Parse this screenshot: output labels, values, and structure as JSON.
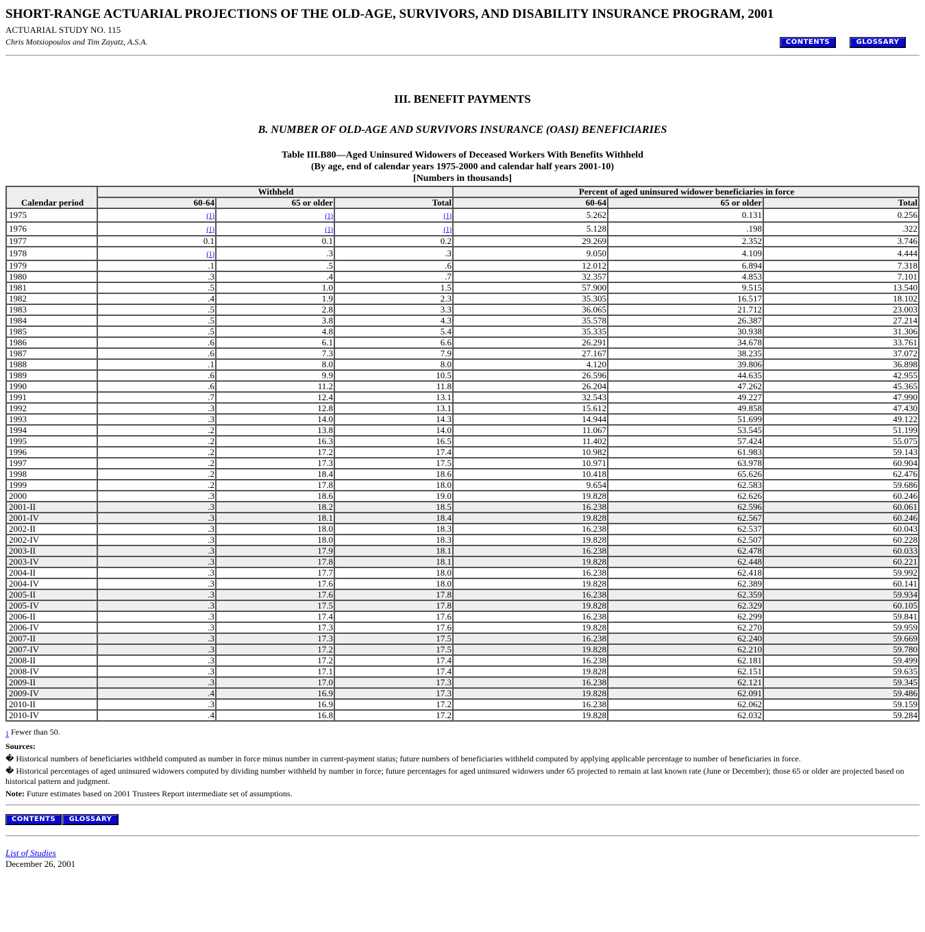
{
  "header": {
    "title": "SHORT-RANGE ACTUARIAL PROJECTIONS OF THE OLD-AGE, SURVIVORS, AND DISABILITY INSURANCE PROGRAM, 2001",
    "study_no": "ACTUARIAL STUDY NO. 115",
    "authors": "Chris Motsiopoulos and Tim Zayatz, A.S.A.",
    "contents_label": "CONTENTS",
    "glossary_label": "GLOSSARY"
  },
  "section_title": "III. BENEFIT PAYMENTS",
  "subsection_title": "B. NUMBER OF OLD-AGE AND SURVIVORS INSURANCE (OASI) BENEFICIARIES",
  "table": {
    "caption_line1": "Table III.B80—Aged Uninsured Widowers of Deceased Workers With Benefits Withheld",
    "caption_line2": "(By age, end of calendar years 1975-2000 and calendar half years 2001-10)",
    "caption_line3": "[Numbers in thousands]",
    "group_withheld": "Withheld",
    "group_percent": "Percent of aged uninsured widower beneficiaries in force",
    "col_period": "Calendar period",
    "col_a": "60-64",
    "col_b": "65 or older",
    "col_c": "Total",
    "footnote_marker": "(1)",
    "rows": [
      {
        "p": "1975",
        "a": "(1)",
        "b": "(1)",
        "c": "(1)",
        "d": "5.262",
        "e": "0.131",
        "f": "0.256",
        "shade": false
      },
      {
        "p": "1976",
        "a": "(1)",
        "b": "(1)",
        "c": "(1)",
        "d": "5.128",
        "e": ".198",
        "f": ".322",
        "shade": false
      },
      {
        "p": "1977",
        "a": "0.1",
        "b": "0.1",
        "c": "0.2",
        "d": "29.269",
        "e": "2.352",
        "f": "3.746",
        "shade": false
      },
      {
        "p": "1978",
        "a": "(1)",
        "b": ".3",
        "c": ".3",
        "d": "9.050",
        "e": "4.109",
        "f": "4.444",
        "shade": false
      },
      {
        "p": "1979",
        "a": ".1",
        "b": ".5",
        "c": ".6",
        "d": "12.012",
        "e": "6.894",
        "f": "7.318",
        "shade": false
      },
      {
        "p": "1980",
        "a": ".3",
        "b": ".4",
        "c": ".7",
        "d": "32.357",
        "e": "4.853",
        "f": "7.101",
        "shade": false
      },
      {
        "p": "1981",
        "a": ".5",
        "b": "1.0",
        "c": "1.5",
        "d": "57.900",
        "e": "9.515",
        "f": "13.540",
        "shade": false
      },
      {
        "p": "1982",
        "a": ".4",
        "b": "1.9",
        "c": "2.3",
        "d": "35.305",
        "e": "16.517",
        "f": "18.102",
        "shade": false
      },
      {
        "p": "1983",
        "a": ".5",
        "b": "2.8",
        "c": "3.3",
        "d": "36.065",
        "e": "21.712",
        "f": "23.003",
        "shade": false
      },
      {
        "p": "1984",
        "a": ".5",
        "b": "3.8",
        "c": "4.3",
        "d": "35.578",
        "e": "26.387",
        "f": "27.214",
        "shade": false
      },
      {
        "p": "1985",
        "a": ".5",
        "b": "4.8",
        "c": "5.4",
        "d": "35.335",
        "e": "30.938",
        "f": "31.306",
        "shade": false
      },
      {
        "p": "1986",
        "a": ".6",
        "b": "6.1",
        "c": "6.6",
        "d": "26.291",
        "e": "34.678",
        "f": "33.761",
        "shade": false
      },
      {
        "p": "1987",
        "a": ".6",
        "b": "7.3",
        "c": "7.9",
        "d": "27.167",
        "e": "38.235",
        "f": "37.072",
        "shade": false
      },
      {
        "p": "1988",
        "a": ".1",
        "b": "8.0",
        "c": "8.0",
        "d": "4.120",
        "e": "39.806",
        "f": "36.898",
        "shade": false
      },
      {
        "p": "1989",
        "a": ".6",
        "b": "9.9",
        "c": "10.5",
        "d": "26.596",
        "e": "44.635",
        "f": "42.955",
        "shade": false
      },
      {
        "p": "1990",
        "a": ".6",
        "b": "11.2",
        "c": "11.8",
        "d": "26.204",
        "e": "47.262",
        "f": "45.365",
        "shade": false
      },
      {
        "p": "1991",
        "a": ".7",
        "b": "12.4",
        "c": "13.1",
        "d": "32.543",
        "e": "49.227",
        "f": "47.990",
        "shade": false
      },
      {
        "p": "1992",
        "a": ".3",
        "b": "12.8",
        "c": "13.1",
        "d": "15.612",
        "e": "49.858",
        "f": "47.430",
        "shade": false
      },
      {
        "p": "1993",
        "a": ".3",
        "b": "14.0",
        "c": "14.3",
        "d": "14.944",
        "e": "51.699",
        "f": "49.122",
        "shade": false
      },
      {
        "p": "1994",
        "a": ".2",
        "b": "13.8",
        "c": "14.0",
        "d": "11.067",
        "e": "53.545",
        "f": "51.199",
        "shade": false
      },
      {
        "p": "1995",
        "a": ".2",
        "b": "16.3",
        "c": "16.5",
        "d": "11.402",
        "e": "57.424",
        "f": "55.075",
        "shade": false
      },
      {
        "p": "1996",
        "a": ".2",
        "b": "17.2",
        "c": "17.4",
        "d": "10.982",
        "e": "61.983",
        "f": "59.143",
        "shade": false
      },
      {
        "p": "1997",
        "a": ".2",
        "b": "17.3",
        "c": "17.5",
        "d": "10.971",
        "e": "63.978",
        "f": "60.904",
        "shade": false
      },
      {
        "p": "1998",
        "a": ".2",
        "b": "18.4",
        "c": "18.6",
        "d": "10.418",
        "e": "65.626",
        "f": "62.476",
        "shade": false
      },
      {
        "p": "1999",
        "a": ".2",
        "b": "17.8",
        "c": "18.0",
        "d": "9.654",
        "e": "62.583",
        "f": "59.686",
        "shade": false
      },
      {
        "p": "2000",
        "a": ".3",
        "b": "18.6",
        "c": "19.0",
        "d": "19.828",
        "e": "62.626",
        "f": "60.246",
        "shade": false
      },
      {
        "p": "2001-II",
        "a": ".3",
        "b": "18.2",
        "c": "18.5",
        "d": "16.238",
        "e": "62.596",
        "f": "60.061",
        "shade": true
      },
      {
        "p": "2001-IV",
        "a": ".3",
        "b": "18.1",
        "c": "18.4",
        "d": "19.828",
        "e": "62.567",
        "f": "60.246",
        "shade": true
      },
      {
        "p": "2002-II",
        "a": ".3",
        "b": "18.0",
        "c": "18.3",
        "d": "16.238",
        "e": "62.537",
        "f": "60.043",
        "shade": false
      },
      {
        "p": "2002-IV",
        "a": ".3",
        "b": "18.0",
        "c": "18.3",
        "d": "19.828",
        "e": "62.507",
        "f": "60.228",
        "shade": false
      },
      {
        "p": "2003-II",
        "a": ".3",
        "b": "17.9",
        "c": "18.1",
        "d": "16.238",
        "e": "62.478",
        "f": "60.033",
        "shade": true
      },
      {
        "p": "2003-IV",
        "a": ".3",
        "b": "17.8",
        "c": "18.1",
        "d": "19.828",
        "e": "62.448",
        "f": "60.221",
        "shade": true
      },
      {
        "p": "2004-II",
        "a": ".3",
        "b": "17.7",
        "c": "18.0",
        "d": "16.238",
        "e": "62.418",
        "f": "59.992",
        "shade": false
      },
      {
        "p": "2004-IV",
        "a": ".3",
        "b": "17.6",
        "c": "18.0",
        "d": "19.828",
        "e": "62.389",
        "f": "60.141",
        "shade": false
      },
      {
        "p": "2005-II",
        "a": ".3",
        "b": "17.6",
        "c": "17.8",
        "d": "16.238",
        "e": "62.359",
        "f": "59.934",
        "shade": true
      },
      {
        "p": "2005-IV",
        "a": ".3",
        "b": "17.5",
        "c": "17.8",
        "d": "19.828",
        "e": "62.329",
        "f": "60.105",
        "shade": true
      },
      {
        "p": "2006-II",
        "a": ".3",
        "b": "17.4",
        "c": "17.6",
        "d": "16.238",
        "e": "62.299",
        "f": "59.841",
        "shade": false
      },
      {
        "p": "2006-IV",
        "a": ".3",
        "b": "17.3",
        "c": "17.6",
        "d": "19.828",
        "e": "62.270",
        "f": "59.959",
        "shade": false
      },
      {
        "p": "2007-II",
        "a": ".3",
        "b": "17.3",
        "c": "17.5",
        "d": "16.238",
        "e": "62.240",
        "f": "59.669",
        "shade": true
      },
      {
        "p": "2007-IV",
        "a": ".3",
        "b": "17.2",
        "c": "17.5",
        "d": "19.828",
        "e": "62.210",
        "f": "59.780",
        "shade": true
      },
      {
        "p": "2008-II",
        "a": ".3",
        "b": "17.2",
        "c": "17.4",
        "d": "16.238",
        "e": "62.181",
        "f": "59.499",
        "shade": false
      },
      {
        "p": "2008-IV",
        "a": ".3",
        "b": "17.1",
        "c": "17.4",
        "d": "19.828",
        "e": "62.151",
        "f": "59.635",
        "shade": false
      },
      {
        "p": "2009-II",
        "a": ".3",
        "b": "17.0",
        "c": "17.3",
        "d": "16.238",
        "e": "62.121",
        "f": "59.345",
        "shade": true
      },
      {
        "p": "2009-IV",
        "a": ".4",
        "b": "16.9",
        "c": "17.3",
        "d": "19.828",
        "e": "62.091",
        "f": "59.486",
        "shade": true
      },
      {
        "p": "2010-II",
        "a": ".3",
        "b": "16.9",
        "c": "17.2",
        "d": "16.238",
        "e": "62.062",
        "f": "59.159",
        "shade": false
      },
      {
        "p": "2010-IV",
        "a": ".4",
        "b": "16.8",
        "c": "17.2",
        "d": "19.828",
        "e": "62.032",
        "f": "59.284",
        "shade": false
      }
    ]
  },
  "notes": {
    "footnote_sup": "1",
    "footnote_text": " Fewer than 50.",
    "sources_label": "Sources:",
    "bullet": "�",
    "source1": " Historical numbers of beneficiaries withheld computed as number in force minus number in current-payment status; future numbers of beneficiaries withheld computed by applying applicable percentage to number of beneficiaries in force.",
    "source2": " Historical percentages of aged uninsured widowers computed by dividing number withheld by number in force; future percentages for aged uninsured widowers under 65 projected to remain at last known rate (June or December); those 65 or older are projected based on historical pattern and judgment.",
    "note_label": "Note:",
    "note_text": " Future estimates based on 2001 Trustees Report intermediate set of assumptions."
  },
  "footer": {
    "list_link": "List of Studies",
    "date": "December 26, 2001"
  }
}
